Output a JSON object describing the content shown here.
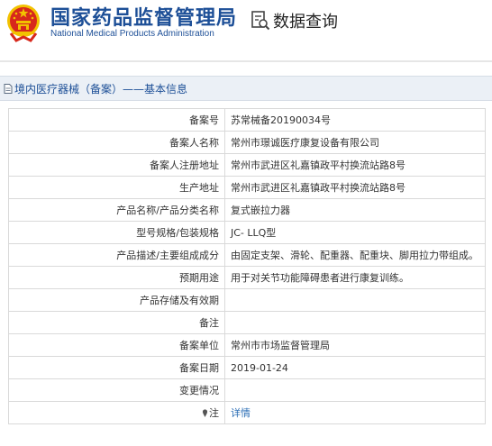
{
  "header": {
    "title_cn": "国家药品监督管理局",
    "title_en": "National Medical Products Administration",
    "query_label": "数据查询"
  },
  "breadcrumb": {
    "text": "境内医疗器械（备案）——基本信息"
  },
  "record": {
    "rows": [
      {
        "label": "备案号",
        "value": "苏常械备20190034号"
      },
      {
        "label": "备案人名称",
        "value": "常州市璟诚医疗康复设备有限公司"
      },
      {
        "label": "备案人注册地址",
        "value": "常州市武进区礼嘉镇政平村换流站路8号"
      },
      {
        "label": "生产地址",
        "value": "常州市武进区礼嘉镇政平村换流站路8号"
      },
      {
        "label": "产品名称/产品分类名称",
        "value": "复式嵌拉力器"
      },
      {
        "label": "型号规格/包装规格",
        "value": "JC- LLQ型"
      },
      {
        "label": "产品描述/主要组成成分",
        "value": "由固定支架、滑轮、配重器、配重块、脚用拉力带组成。"
      },
      {
        "label": "预期用途",
        "value": "用于对关节功能障碍患者进行康复训练。"
      },
      {
        "label": "产品存储及有效期",
        "value": ""
      },
      {
        "label": "备注",
        "value": ""
      },
      {
        "label": "备案单位",
        "value": "常州市市场监督管理局"
      },
      {
        "label": "备案日期",
        "value": "2019-01-24"
      },
      {
        "label": "变更情况",
        "value": ""
      }
    ],
    "note_label": "注",
    "note_link": "详情"
  },
  "colors": {
    "brand_blue": "#1d4f97",
    "emblem_red": "#d7281c",
    "emblem_gold": "#f2c200",
    "link_blue": "#2a6db5"
  },
  "icons": [
    "national-emblem-icon",
    "data-query-icon",
    "document-icon",
    "pin-icon"
  ]
}
